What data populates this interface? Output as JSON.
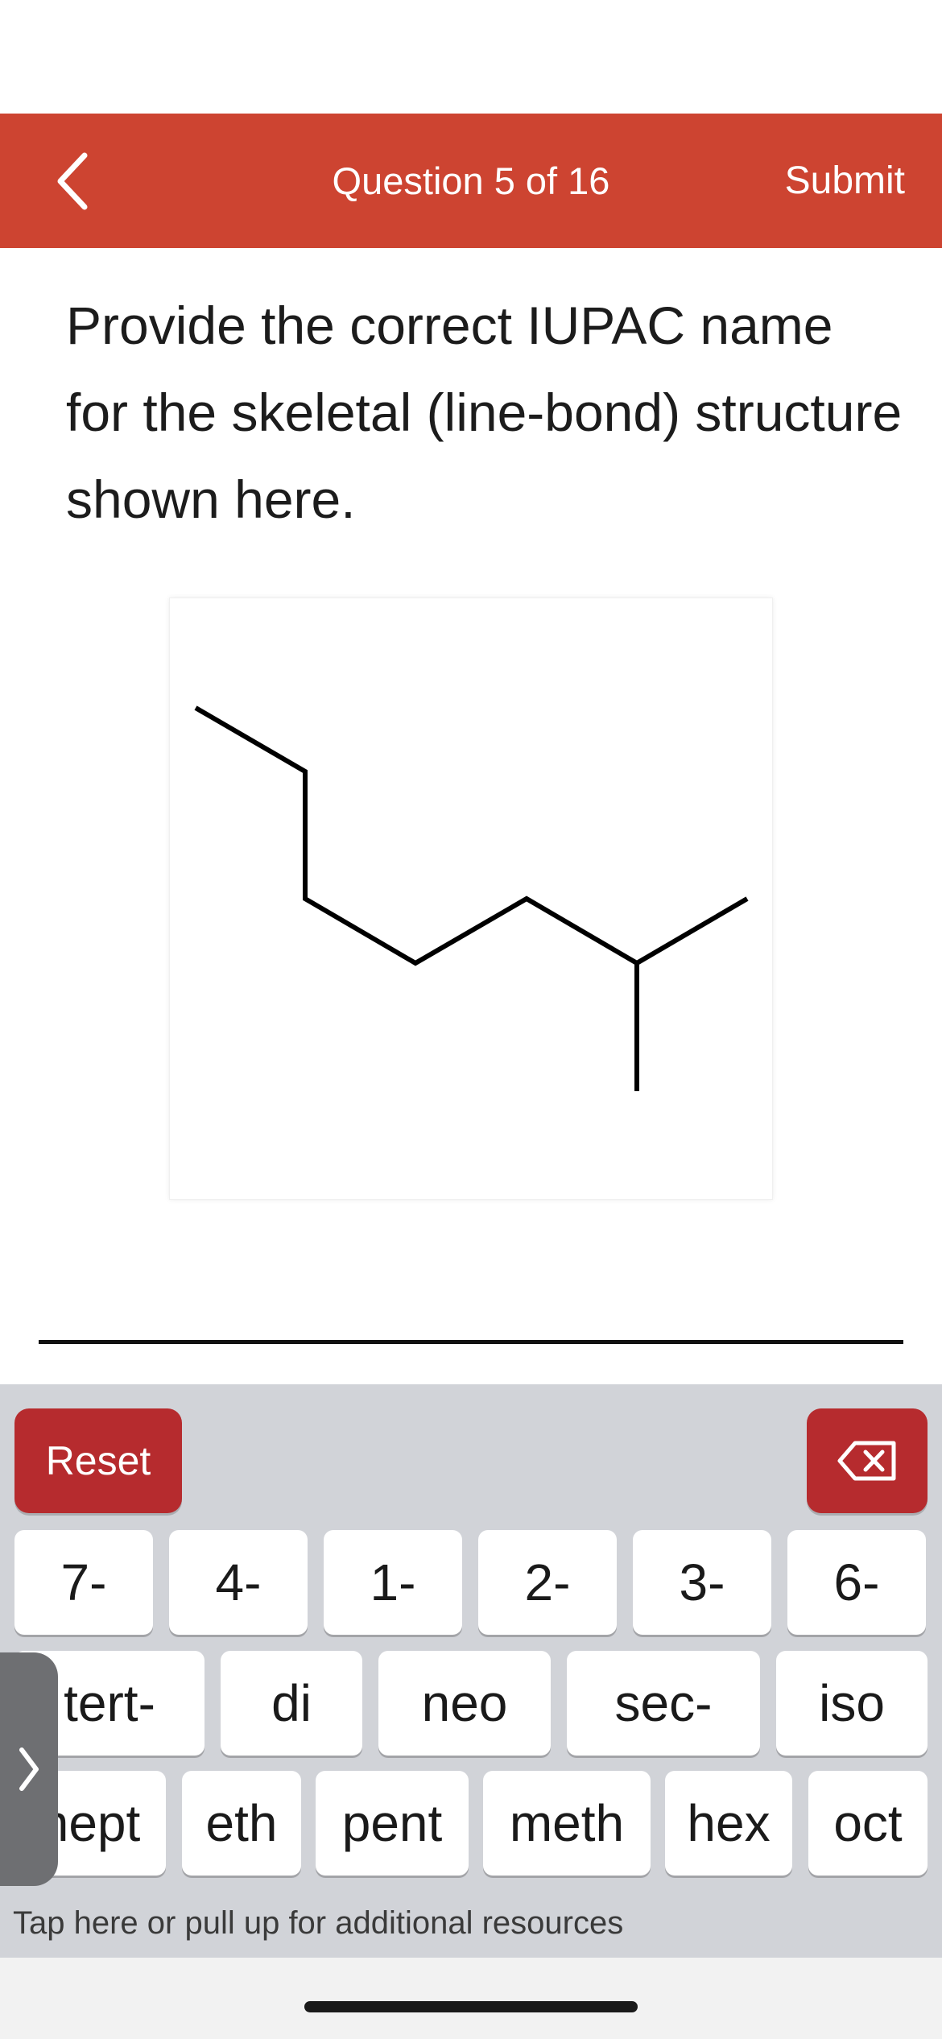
{
  "header": {
    "title": "Question 5 of 16",
    "submit_label": "Submit",
    "background_color": "#cd4431",
    "back_icon": "chevron-left-icon"
  },
  "question": {
    "text": "Provide the correct IUPAC name for the skeletal (line-bond) structure shown here."
  },
  "structure": {
    "type": "skeletal-structure",
    "description_hidden": true
  },
  "answer": {
    "value": ""
  },
  "keyboard": {
    "reset_label": "Reset",
    "delete_icon": "backspace-icon",
    "accent_color": "#b62b2e",
    "row1": [
      "7-",
      "4-",
      "1-",
      "2-",
      "3-",
      "6-"
    ],
    "row2": [
      "tert-",
      "di",
      "neo",
      "sec-",
      "iso"
    ],
    "row3": [
      "hept",
      "eth",
      "pent",
      "meth",
      "hex",
      "oct"
    ]
  },
  "resources": {
    "label": "Tap here or pull up for additional resources",
    "handle_icon": "chevron-right-icon"
  }
}
